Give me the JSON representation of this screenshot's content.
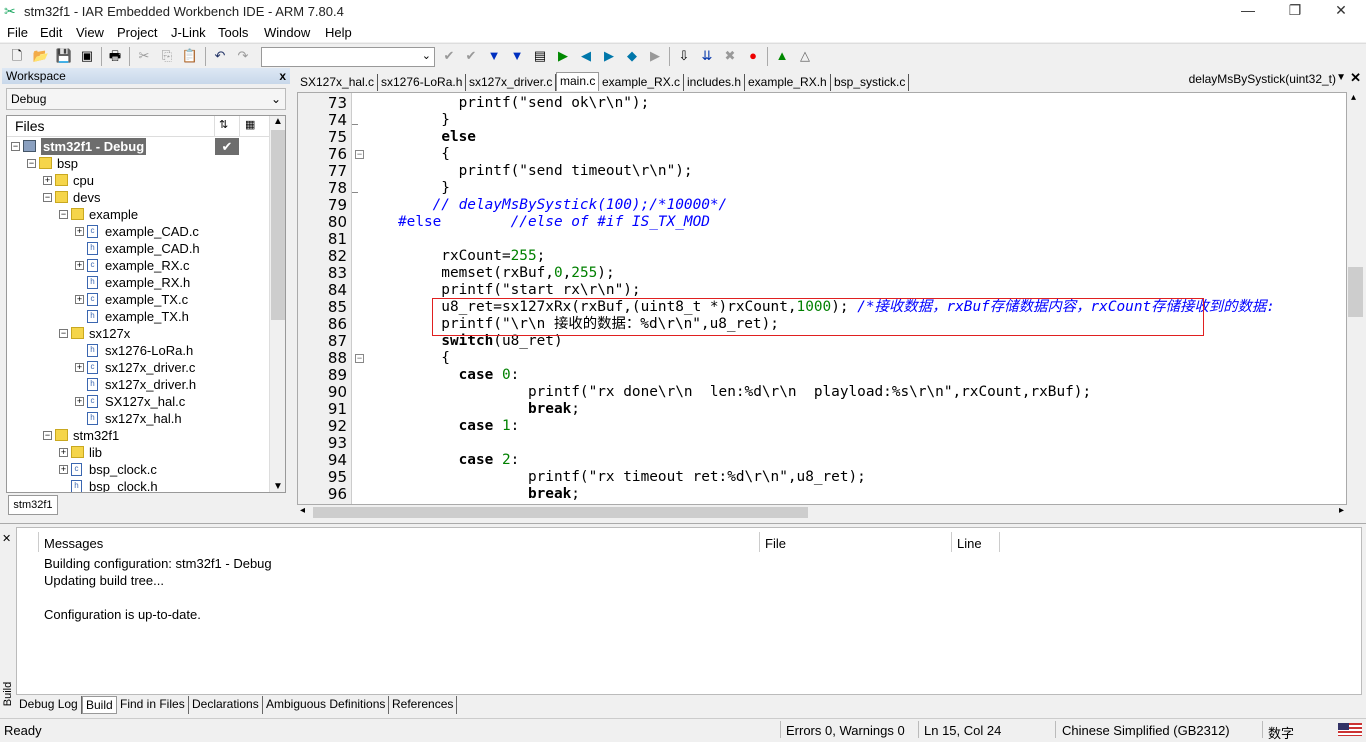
{
  "window": {
    "title": "stm32f1 - IAR Embedded Workbench IDE - ARM 7.80.4"
  },
  "menu": [
    "File",
    "Edit",
    "View",
    "Project",
    "J-Link",
    "Tools",
    "Window",
    "Help"
  ],
  "toolbar": {
    "combo_value": ""
  },
  "workspace": {
    "title": "Workspace",
    "close": "x",
    "config": "Debug",
    "files_header": "Files",
    "bottom_tab": "stm32f1",
    "tree": [
      {
        "label": "stm32f1 - Debug",
        "level": 0,
        "exp": "-",
        "icon": "project",
        "selected": true
      },
      {
        "label": "bsp",
        "level": 1,
        "exp": "-",
        "icon": "folder"
      },
      {
        "label": "cpu",
        "level": 2,
        "exp": "+",
        "icon": "folder"
      },
      {
        "label": "devs",
        "level": 2,
        "exp": "-",
        "icon": "folder"
      },
      {
        "label": "example",
        "level": 3,
        "exp": "-",
        "icon": "folder"
      },
      {
        "label": "example_CAD.c",
        "level": 4,
        "exp": "+",
        "icon": "c"
      },
      {
        "label": "example_CAD.h",
        "level": 4,
        "exp": "",
        "icon": "h"
      },
      {
        "label": "example_RX.c",
        "level": 4,
        "exp": "+",
        "icon": "c"
      },
      {
        "label": "example_RX.h",
        "level": 4,
        "exp": "",
        "icon": "h"
      },
      {
        "label": "example_TX.c",
        "level": 4,
        "exp": "+",
        "icon": "c"
      },
      {
        "label": "example_TX.h",
        "level": 4,
        "exp": "",
        "icon": "h"
      },
      {
        "label": "sx127x",
        "level": 3,
        "exp": "-",
        "icon": "folder"
      },
      {
        "label": "sx1276-LoRa.h",
        "level": 4,
        "exp": "",
        "icon": "h"
      },
      {
        "label": "sx127x_driver.c",
        "level": 4,
        "exp": "+",
        "icon": "c"
      },
      {
        "label": "sx127x_driver.h",
        "level": 4,
        "exp": "",
        "icon": "h"
      },
      {
        "label": "SX127x_hal.c",
        "level": 4,
        "exp": "+",
        "icon": "c"
      },
      {
        "label": "sx127x_hal.h",
        "level": 4,
        "exp": "",
        "icon": "h"
      },
      {
        "label": "stm32f1",
        "level": 2,
        "exp": "-",
        "icon": "folder"
      },
      {
        "label": "lib",
        "level": 3,
        "exp": "+",
        "icon": "folder"
      },
      {
        "label": "bsp_clock.c",
        "level": 3,
        "exp": "+",
        "icon": "c"
      },
      {
        "label": "bsp_clock.h",
        "level": 3,
        "exp": "",
        "icon": "h"
      }
    ]
  },
  "editor": {
    "tabs": [
      "SX127x_hal.c",
      "sx1276-LoRa.h",
      "sx127x_driver.c",
      "main.c",
      "example_RX.c",
      "includes.h",
      "example_RX.h",
      "bsp_systick.c"
    ],
    "active_tab": "main.c",
    "function_selector": "delayMsBySystick(uint32_t)",
    "lines": [
      {
        "n": "73",
        "s": [
          [
            "          printf(\"send ok\\r\\n\");",
            ""
          ]
        ]
      },
      {
        "n": "74",
        "s": [
          [
            "        }",
            ""
          ]
        ]
      },
      {
        "n": "75",
        "s": [
          [
            "        ",
            ""
          ],
          [
            "else",
            "kw"
          ]
        ]
      },
      {
        "n": "76",
        "s": [
          [
            "        {",
            ""
          ]
        ],
        "fold": true
      },
      {
        "n": "77",
        "s": [
          [
            "          printf(\"send timeout\\r\\n\");",
            ""
          ]
        ]
      },
      {
        "n": "78",
        "s": [
          [
            "        }",
            ""
          ]
        ]
      },
      {
        "n": "79",
        "s": [
          [
            "       // delayMsBySystick(100);/*10000*/",
            "cm"
          ]
        ]
      },
      {
        "n": "80",
        "s": [
          [
            "   #else",
            "pp"
          ],
          [
            "        //else of #if IS_TX_MOD",
            "cm"
          ]
        ]
      },
      {
        "n": "81",
        "s": [
          [
            "",
            ""
          ]
        ]
      },
      {
        "n": "82",
        "s": [
          [
            "        rxCount=",
            ""
          ],
          [
            "255",
            "num"
          ],
          [
            ";",
            ""
          ]
        ]
      },
      {
        "n": "83",
        "s": [
          [
            "        memset(rxBuf,",
            ""
          ],
          [
            "0",
            "num"
          ],
          [
            ",",
            ""
          ],
          [
            "255",
            "num"
          ],
          [
            ");",
            ""
          ]
        ]
      },
      {
        "n": "84",
        "s": [
          [
            "        printf(\"start rx\\r\\n\");",
            ""
          ]
        ]
      },
      {
        "n": "85",
        "s": [
          [
            "        u8_ret=sx127xRx(rxBuf,(uint8_t *)rxCount,",
            ""
          ],
          [
            "1000",
            "num"
          ],
          [
            "); ",
            ""
          ],
          [
            "/*接收数据，rxBuf存储数据内容，rxCount存储接收到的数据:",
            "cm"
          ]
        ]
      },
      {
        "n": "86",
        "s": [
          [
            "        printf(\"\\r\\n 接收的数据：%d\\r\\n\",u8_ret);",
            ""
          ]
        ]
      },
      {
        "n": "87",
        "s": [
          [
            "        ",
            ""
          ],
          [
            "switch",
            "kw"
          ],
          [
            "(u8_ret)",
            ""
          ]
        ]
      },
      {
        "n": "88",
        "s": [
          [
            "        {",
            ""
          ]
        ],
        "fold": true
      },
      {
        "n": "89",
        "s": [
          [
            "          ",
            ""
          ],
          [
            "case",
            "kw"
          ],
          [
            " ",
            ""
          ],
          [
            "0",
            "num"
          ],
          [
            ":",
            ""
          ]
        ]
      },
      {
        "n": "90",
        "s": [
          [
            "                  printf(\"rx done\\r\\n  len:%d\\r\\n  playload:%s\\r\\n\",rxCount,rxBuf);",
            ""
          ]
        ]
      },
      {
        "n": "91",
        "s": [
          [
            "                  ",
            ""
          ],
          [
            "break",
            "kw"
          ],
          [
            ";",
            ""
          ]
        ]
      },
      {
        "n": "92",
        "s": [
          [
            "          ",
            ""
          ],
          [
            "case",
            "kw"
          ],
          [
            " ",
            ""
          ],
          [
            "1",
            "num"
          ],
          [
            ":",
            ""
          ]
        ]
      },
      {
        "n": "93",
        "s": [
          [
            "",
            ""
          ]
        ]
      },
      {
        "n": "94",
        "s": [
          [
            "          ",
            ""
          ],
          [
            "case",
            "kw"
          ],
          [
            " ",
            ""
          ],
          [
            "2",
            "num"
          ],
          [
            ":",
            ""
          ]
        ]
      },
      {
        "n": "95",
        "s": [
          [
            "                  printf(\"rx timeout ret:%d\\r\\n\",u8_ret);",
            ""
          ]
        ]
      },
      {
        "n": "96",
        "s": [
          [
            "                  ",
            ""
          ],
          [
            "break",
            "kw"
          ],
          [
            ";",
            ""
          ]
        ]
      }
    ]
  },
  "messages": {
    "side_label": "Build",
    "headers": {
      "messages": "Messages",
      "file": "File",
      "line": "Line"
    },
    "lines": [
      "Building configuration: stm32f1 - Debug",
      "Updating build tree...",
      "",
      "Configuration is up-to-date."
    ],
    "tabs": [
      "Debug Log",
      "Build",
      "Find in Files",
      "Declarations",
      "Ambiguous Definitions",
      "References"
    ],
    "active_tab": "Build"
  },
  "status": {
    "ready": "Ready",
    "errors": "Errors 0, Warnings 0",
    "position": "Ln 15, Col 24",
    "encoding": "Chinese Simplified (GB2312)",
    "ime": "数字"
  },
  "colors": {
    "keyword": "#000000",
    "number": "#008000",
    "comment": "#0000ff",
    "highlight_box": "#e02020"
  }
}
